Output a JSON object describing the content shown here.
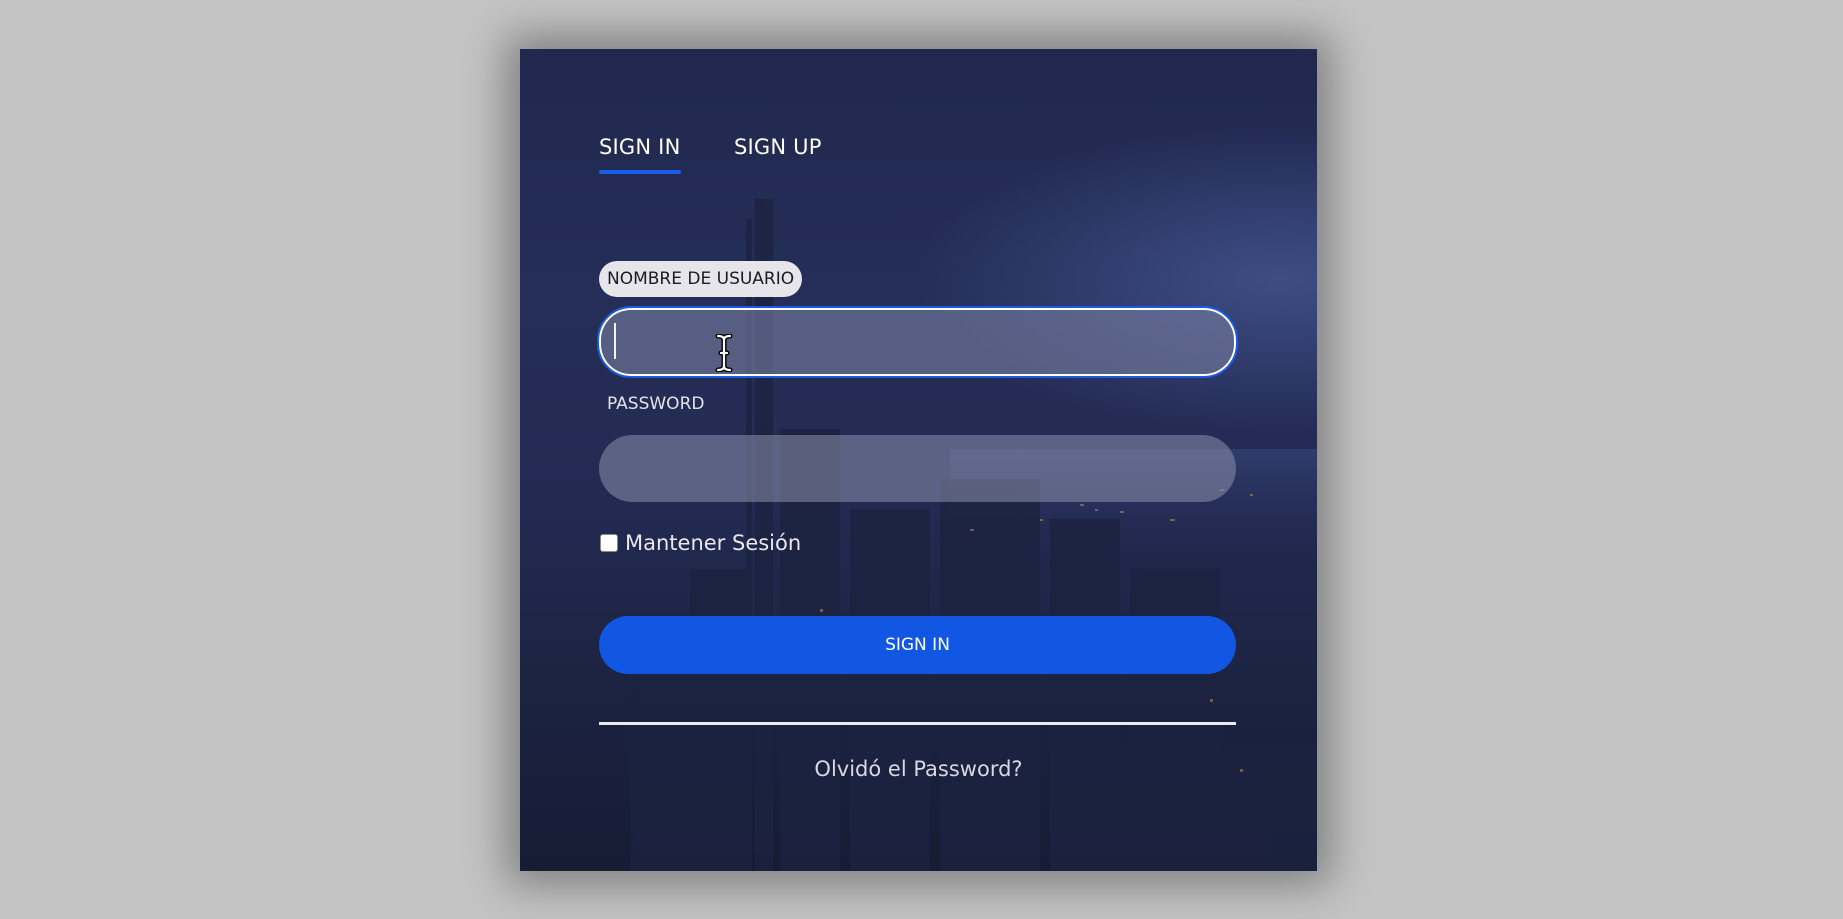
{
  "tabs": {
    "signin": "SIGN IN",
    "signup": "SIGN UP",
    "active": "signin"
  },
  "form": {
    "username_label": "NOMBRE DE USUARIO",
    "username_value": "",
    "password_label": "PASSWORD",
    "password_value": "",
    "remember_label": "Mantener Sesión",
    "remember_checked": false,
    "submit_label": "SIGN IN",
    "forgot_label": "Olvidó el Password?"
  },
  "colors": {
    "accent": "#1157e4",
    "page_background": "#c4c4c4",
    "card_background": "#232a52"
  },
  "icons": {
    "cursor": "text-cursor-icon"
  }
}
